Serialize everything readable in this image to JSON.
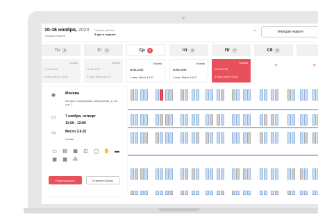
{
  "header": {
    "date_range": "10-16 ноября",
    "year": "2020",
    "week_label": "текущая неделя",
    "schedule_label": "График работы:",
    "schedule_value": "3 дня в неделю",
    "nav_prev": "←",
    "current_week_button": "текущая неделя"
  },
  "days": [
    {
      "name": "Пн",
      "num": "3"
    },
    {
      "name": "Вт",
      "num": "4"
    },
    {
      "name": "Ср",
      "num": "5"
    },
    {
      "name": "Чт",
      "num": "6"
    },
    {
      "name": "Пт",
      "num": "7"
    },
    {
      "name": "Сб",
      "num": "8"
    }
  ],
  "cards": [
    {
      "city": "Москва",
      "time": "11:00-12:00",
      "place": "3 этаж, Место 3.6.02"
    },
    {
      "city": "Москва",
      "time": "11:00-12:00",
      "place": "3 этаж, Место 3.6.02"
    },
    {
      "city": "Москва",
      "time": "11:00-12:00",
      "place": "3 этаж, Место 3.6.02"
    },
    {
      "city": "Москва",
      "time": "11:00-12:00",
      "place": "3 этаж, Место 3.6.02"
    },
    {
      "city": "Москва",
      "time": "11:00-12:00",
      "place": "3 этаж, Место 3.6.02"
    }
  ],
  "add_symbol": "+",
  "detail": {
    "location_title": "Москва",
    "location_address": "Москва, Озерковская набережная, д. 26, стр. 2",
    "date": "7 ноября, четверг",
    "time": "11:00 - 12:00",
    "seat": "Место 3.6.02",
    "floor": "3 этаж",
    "edit_button": "Редактировать",
    "cancel_button": "Отменить бронь"
  },
  "icons": {
    "location": "◉",
    "calendar": "▭",
    "monitor": "▭",
    "amenities": [
      "▭",
      "▤",
      "▦",
      "◫",
      "◯",
      "✋",
      "▬",
      "▦",
      "▦",
      "⁂"
    ]
  },
  "colors": {
    "accent": "#e8505b",
    "desk": "#c9dcf1",
    "desk_busy": "#cfcfcf"
  }
}
